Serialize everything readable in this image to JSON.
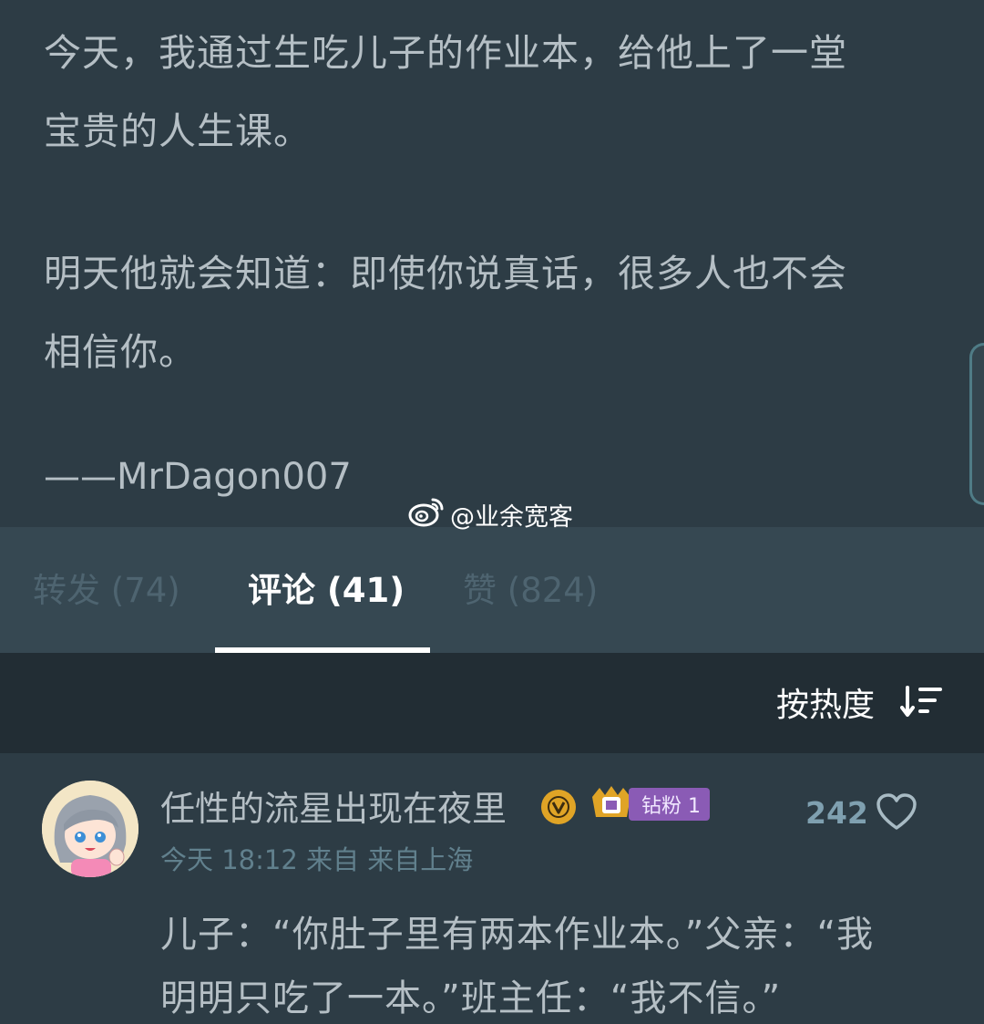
{
  "post": {
    "lines": [
      "今天，我通过生吃儿子的作业本，给他上了一堂",
      "宝贵的人生课。",
      "明天他就会知道：即使你说真话，很多人也不会",
      "相信你。",
      "——MrDagon007"
    ],
    "watermark": "@业余宽客"
  },
  "tabs": {
    "repost": "转发 (74)",
    "comments": "评论 (41)",
    "likes": "赞 (824)",
    "active": "comments"
  },
  "sort": {
    "label": "按热度"
  },
  "comment": {
    "username": "任性的流星出现在夜里",
    "fan_badge": "钻粉 1",
    "meta": "今天 18:12 来自 来自上海",
    "like_count": "242",
    "lines": [
      "儿子：“你肚子里有两本作业本。”父亲：“我",
      "明明只吃了一本。”班主任：“我不信。”"
    ]
  },
  "colors": {
    "background": "#2d3c45",
    "tabbar": "#364852",
    "sortbar": "#222d34",
    "text": "#b5bfc5",
    "vip_gold": "#e0a426",
    "fan_purple": "#8a5bb5"
  },
  "icons": [
    "weibo-icon",
    "sort-icon",
    "verified-icon",
    "crown-icon",
    "heart-icon"
  ]
}
